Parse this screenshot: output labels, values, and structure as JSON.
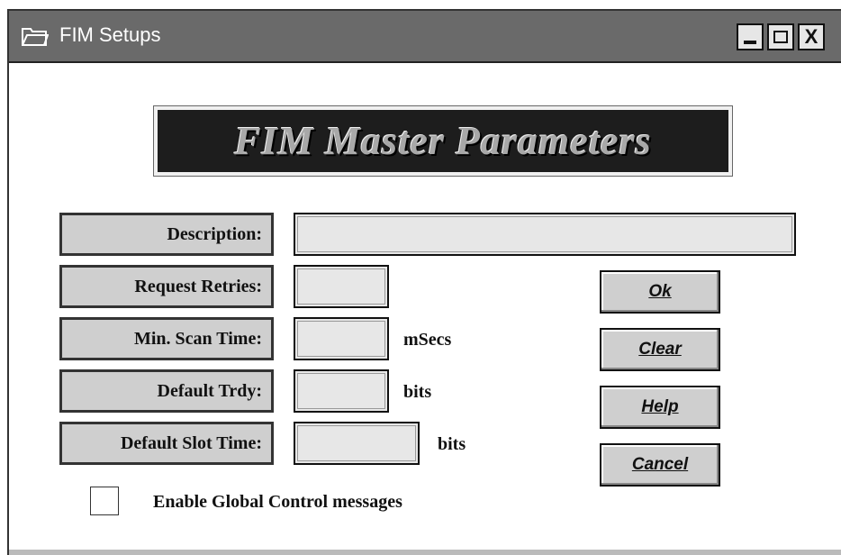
{
  "window": {
    "title": "FIM Setups",
    "close_glyph": "X"
  },
  "banner": {
    "text": "FIM Master Parameters"
  },
  "fields": {
    "description": {
      "label": "Description:",
      "value": ""
    },
    "request_retries": {
      "label": "Request Retries:",
      "value": ""
    },
    "min_scan_time": {
      "label": "Min. Scan Time:",
      "value": "",
      "unit": "mSecs"
    },
    "default_trdy": {
      "label": "Default Trdy:",
      "value": "",
      "unit": "bits"
    },
    "default_slot_time": {
      "label": "Default Slot Time:",
      "value": "",
      "unit": "bits"
    }
  },
  "buttons": {
    "ok": "Ok",
    "clear": "Clear",
    "help": "Help",
    "cancel": "Cancel"
  },
  "checkbox": {
    "label": "Enable Global Control messages",
    "checked": false
  },
  "icons": {
    "title": "folder-icon"
  },
  "colors": {
    "titlebar": "#6a6a6a",
    "banner_bg": "#1d1d1d",
    "label_bg": "#cfcfcf",
    "field_bg": "#e7e7e7"
  }
}
